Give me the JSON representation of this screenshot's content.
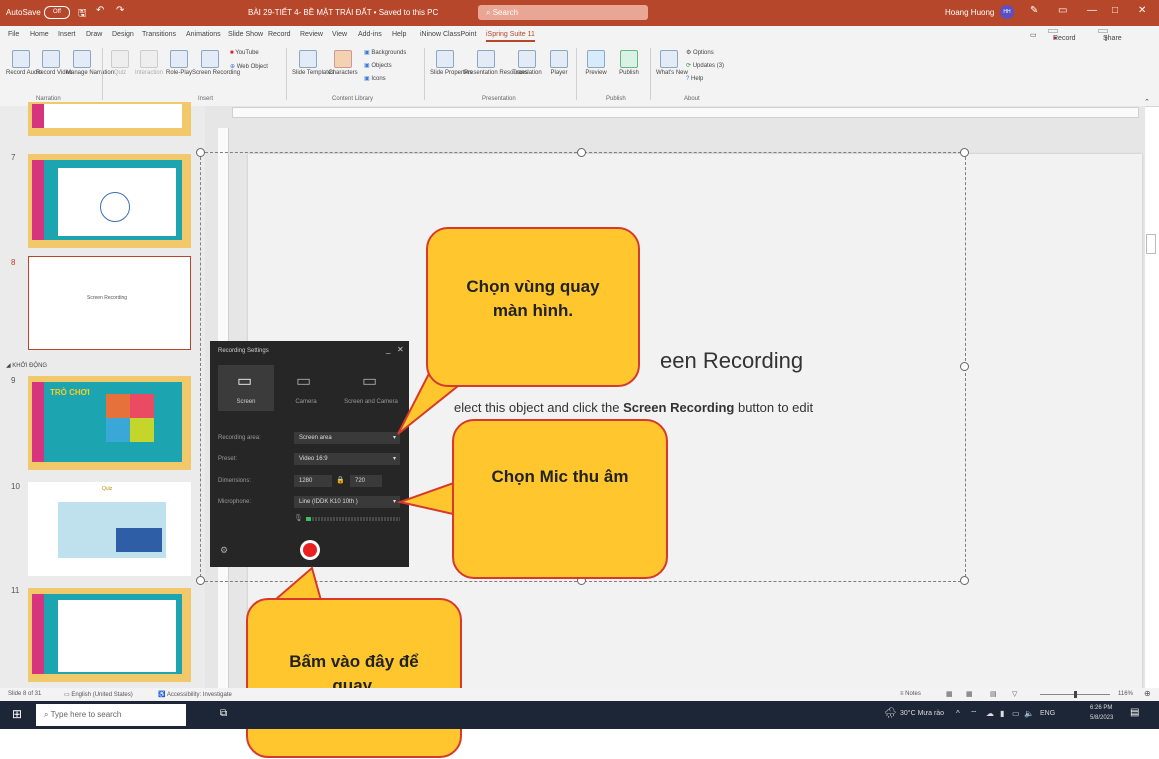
{
  "titlebar": {
    "autosave": "AutoSave",
    "autosave_state": "Off",
    "doc_title": "BÀI 29-TIẾT 4- BỀ MẶT TRÁI ĐẤT  •  Saved to this PC",
    "search": "Search",
    "user": "Hoang Huong",
    "user_initials": "HH",
    "controls": [
      "—",
      "□",
      "✕"
    ]
  },
  "tabs": [
    "File",
    "Home",
    "Insert",
    "Draw",
    "Design",
    "Transitions",
    "Animations",
    "Slide Show",
    "Record",
    "Review",
    "View",
    "Add-ins",
    "Help",
    "iNinow ClassPoint",
    "iSpring Suite 11"
  ],
  "ribbon_right": {
    "record": "Record",
    "share": "Share"
  },
  "ribbon": {
    "narration": {
      "buttons": [
        "Record Audio",
        "Record Video",
        "Manage Narration"
      ],
      "label": "Narration"
    },
    "insert": {
      "buttons": [
        "Quiz",
        "Interaction",
        "Role-Play",
        "Screen Recording"
      ],
      "youtube": "YouTube",
      "web_object": "Web Object",
      "label": "Insert"
    },
    "content_library": {
      "buttons": [
        "Slide Templates",
        "Characters"
      ],
      "small": [
        "Backgrounds",
        "Objects",
        "Icons"
      ],
      "label": "Content Library"
    },
    "presentation": {
      "buttons": [
        "Slide Properties",
        "Presentation Resources",
        "Translation",
        "Player"
      ],
      "label": "Presentation"
    },
    "publish": {
      "buttons": [
        "Preview",
        "Publish"
      ],
      "label": "Publish"
    },
    "about": {
      "buttons": [
        "What's New"
      ],
      "small": [
        "Options",
        "Updates (3)",
        "Help"
      ],
      "label": "About"
    }
  },
  "ruler_ticks": [
    "8",
    "7",
    "6",
    "5",
    "4",
    "3",
    "2",
    "1",
    "0",
    "1",
    "2",
    "3",
    "4",
    "5",
    "6"
  ],
  "thumbnails": {
    "numbers": [
      "7",
      "8",
      "9",
      "10",
      "11"
    ],
    "section": "KHỞI ĐỘNG",
    "slide8_text": "Screen Recording",
    "slide9_text": "TRÒ CHƠI",
    "slide10_text": "Quiz"
  },
  "slide": {
    "title": "een Recording",
    "subtitle_prefix": "elect this object and click the ",
    "subtitle_bold": "Screen Recording",
    "subtitle_suffix": " button to edit"
  },
  "dialog": {
    "title": "Recording Settings",
    "modes": [
      "Screen",
      "Camera",
      "Screen and Camera"
    ],
    "fields": [
      {
        "label": "Recording area:",
        "value": "Screen area"
      },
      {
        "label": "Preset:",
        "value": "Video 16:9"
      },
      {
        "label": "Dimensions:",
        "value1": "1280",
        "value2": "720"
      },
      {
        "label": "Microphone:",
        "value": "Line (IDDK K10 10th  )"
      }
    ]
  },
  "callouts": {
    "area": "Chọn vùng quay màn hình.",
    "mic": "Chọn Mic thu âm",
    "record": "Bấm vào đây để quay."
  },
  "status": {
    "slide": "Slide 8 of 31",
    "language": "English (United States)",
    "accessibility": "Accessibility: Investigate",
    "notes": "Notes",
    "zoom": "116%"
  },
  "taskbar": {
    "search_placeholder": "Type here to search",
    "weather": "30°C  Mưa rào",
    "lang": "ENG",
    "time": "6:26 PM",
    "date": "5/8/2023"
  },
  "colors": {
    "accent": "#b7472a",
    "callout_fill": "#ffc62e",
    "callout_border": "#d73a2c",
    "record_red": "#e8201f"
  }
}
